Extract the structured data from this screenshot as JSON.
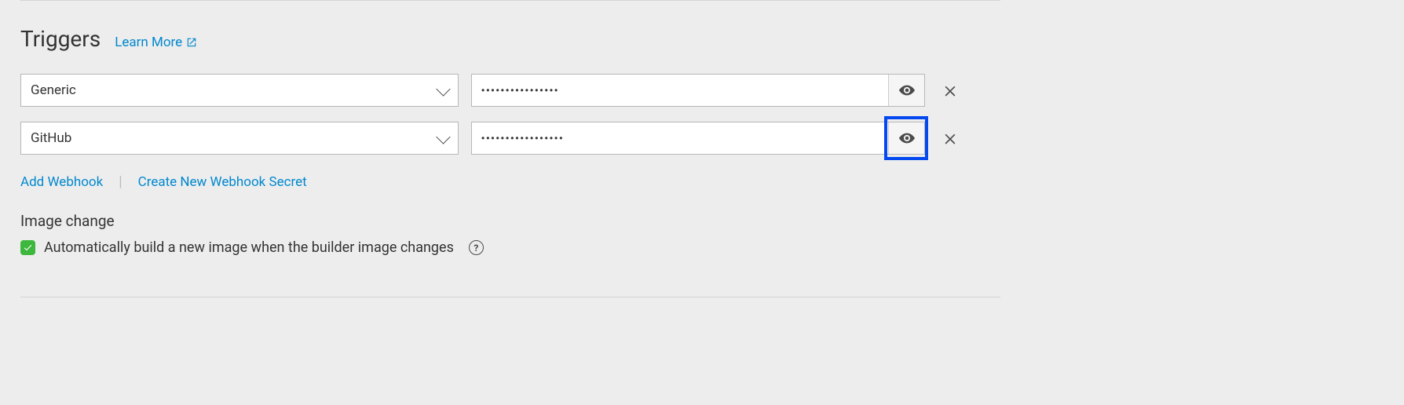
{
  "section": {
    "title": "Triggers",
    "learnMore": "Learn More"
  },
  "triggers": [
    {
      "type": "Generic",
      "highlighted": false
    },
    {
      "type": "GitHub",
      "highlighted": true
    }
  ],
  "actions": {
    "addWebhook": "Add Webhook",
    "createSecret": "Create New Webhook Secret"
  },
  "imageChange": {
    "heading": "Image change",
    "checked": true,
    "label": "Automatically build a new image when the builder image changes"
  }
}
